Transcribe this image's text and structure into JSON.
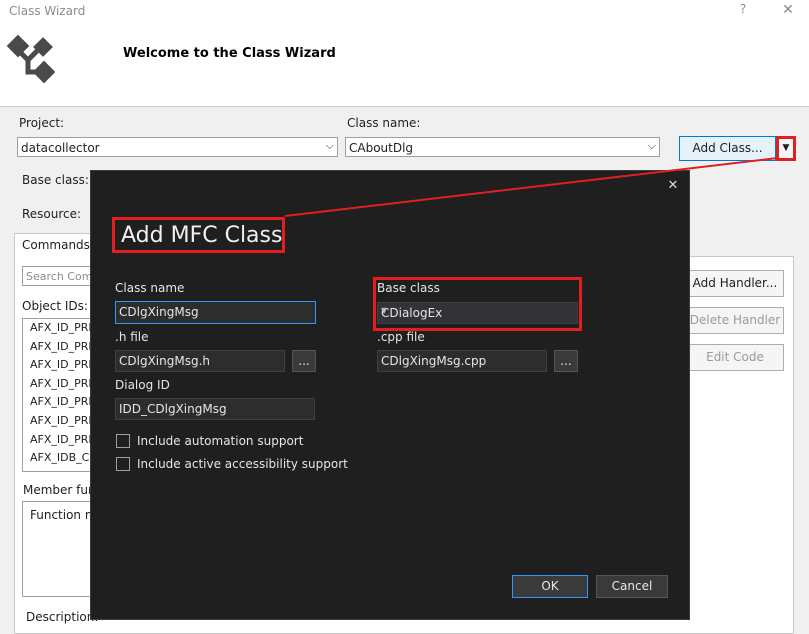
{
  "window": {
    "title": "Class Wizard",
    "help_glyph": "?",
    "close_glyph": "✕",
    "header_title": "Welcome to the Class Wizard"
  },
  "main": {
    "project_label": "Project:",
    "project_value": "datacollector",
    "class_name_label": "Class name:",
    "class_name_value": "CAboutDlg",
    "add_class_button": "Add Class...",
    "add_class_dropdown": "▼",
    "base_class_label": "Base class:",
    "resource_label": "Resource:",
    "tab_commands": "Commands",
    "search_placeholder": "Search Com",
    "object_ids_label": "Object IDs:",
    "object_ids": [
      "AFX_ID_PRE",
      "AFX_ID_PRE",
      "AFX_ID_PRE",
      "AFX_ID_PRE",
      "AFX_ID_PRE",
      "AFX_ID_PRE",
      "AFX_ID_PRE",
      "AFX_IDB_CI"
    ],
    "member_functions_label": "Member fun",
    "function_name_header": "Function na",
    "add_handler_button": "Add Handler...",
    "delete_handler_button": "Delete Handler",
    "edit_code_button": "Edit Code",
    "description_label": "Description:"
  },
  "dialog": {
    "title": "Add MFC Class",
    "close_glyph": "✕",
    "class_name_label": "Class name",
    "class_name_value": "CDlgXingMsg",
    "base_class_label": "Base class",
    "base_class_value": "CDialogEx",
    "h_file_label": ".h file",
    "h_file_value": "CDlgXingMsg.h",
    "cpp_file_label": ".cpp file",
    "cpp_file_value": "CDlgXingMsg.cpp",
    "browse_label": "...",
    "dialog_id_label": "Dialog ID",
    "dialog_id_value": "IDD_CDlgXingMsg",
    "automation_label": "Include automation support",
    "accessibility_label": "Include active accessibility support",
    "ok_button": "OK",
    "cancel_button": "Cancel"
  },
  "colors": {
    "highlight_red": "#e02020",
    "focus_blue": "#3794ff",
    "dialog_bg": "#1f1f1f"
  }
}
